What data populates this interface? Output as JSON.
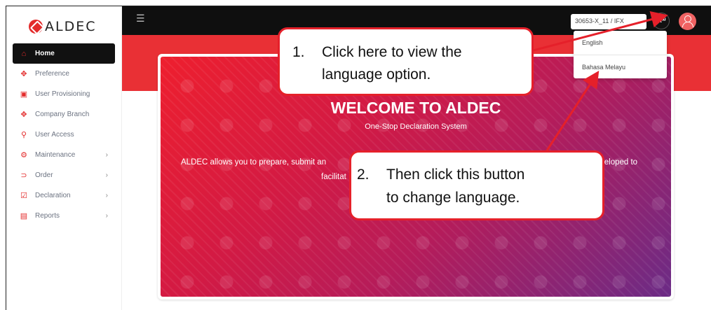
{
  "app": {
    "logo_text": "ALDEC"
  },
  "sidebar": {
    "items": [
      {
        "label": "Home",
        "icon": "home-icon",
        "glyph": "⌂",
        "active": true,
        "chevron": false
      },
      {
        "label": "Preference",
        "icon": "preference-icon",
        "glyph": "✥",
        "active": false,
        "chevron": false
      },
      {
        "label": "User Provisioning",
        "icon": "user-provisioning-icon",
        "glyph": "▣",
        "active": false,
        "chevron": false
      },
      {
        "label": "Company Branch",
        "icon": "company-branch-icon",
        "glyph": "✥",
        "active": false,
        "chevron": false
      },
      {
        "label": "User Access",
        "icon": "user-access-icon",
        "glyph": "⚲",
        "active": false,
        "chevron": false
      },
      {
        "label": "Maintenance",
        "icon": "maintenance-icon",
        "glyph": "⚙",
        "active": false,
        "chevron": true
      },
      {
        "label": "Order",
        "icon": "order-icon",
        "glyph": "⊃",
        "active": false,
        "chevron": true
      },
      {
        "label": "Declaration",
        "icon": "declaration-icon",
        "glyph": "☑",
        "active": false,
        "chevron": true
      },
      {
        "label": "Reports",
        "icon": "reports-icon",
        "glyph": "▤",
        "active": false,
        "chevron": true
      }
    ]
  },
  "topbar": {
    "company_select_value": "30653-X_11 / IFX",
    "lang_button_label": "Aᵚ"
  },
  "language_menu": {
    "options": [
      "English",
      "Bahasa Melayu"
    ]
  },
  "banner": {
    "title": "WELCOME TO ALDEC",
    "subtitle": "One-Stop Declaration System",
    "description_line1_start": "ALDEC allows you to prepare, submit an",
    "description_line1_end": "veloped to",
    "description_line2_start": "facilitat"
  },
  "callouts": {
    "step1_number": "1.",
    "step1_line1": "Click here to view the",
    "step1_line2": "language option.",
    "step2_number": "2.",
    "step2_line1": "Then click this button",
    "step2_line2": "to change language."
  },
  "colors": {
    "accent": "#e5202a",
    "topbar": "#0f0f0f",
    "red_band": "#e93035"
  }
}
